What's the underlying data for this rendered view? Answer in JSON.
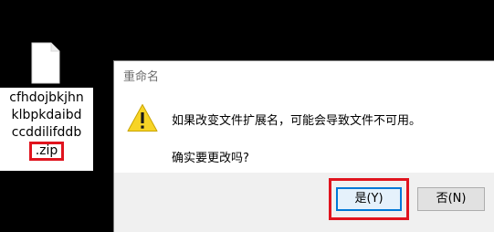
{
  "desktop": {
    "file": {
      "icon": "blank-file-icon",
      "name_lines": [
        "cfhdojbkjhn",
        "klbpkdaibd",
        "ccddilifddb"
      ],
      "extension": ".zip",
      "highlight_color": "#e0141e"
    }
  },
  "dialog": {
    "title": "重命名",
    "icon": "warning-icon",
    "message": "如果改变文件扩展名，可能会导致文件不可用。",
    "question": "确实要更改吗?",
    "buttons": {
      "yes_label": "是(Y)",
      "no_label": "否(N)"
    },
    "highlight_color": "#e0141e",
    "focus_color": "#0078d7"
  }
}
